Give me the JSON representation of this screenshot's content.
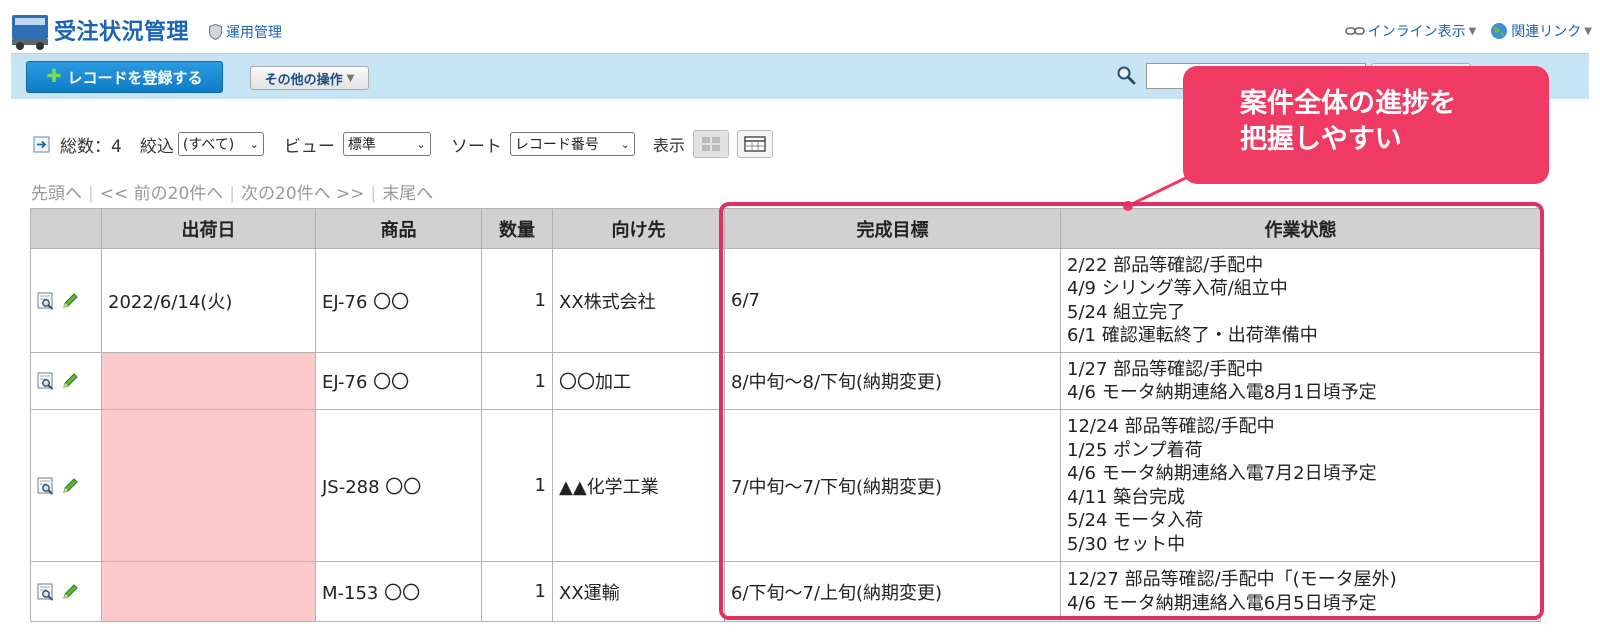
{
  "header": {
    "title": "受注状況管理",
    "admin_label": "運用管理",
    "inline_view": "インライン表示",
    "related_links": "関連リンク"
  },
  "toolbar": {
    "add_record": "レコードを登録する",
    "other_ops": "その他の操作"
  },
  "controls": {
    "total_label": "総数：4",
    "filter_label": "絞込",
    "filter_value": "(すべて)",
    "view_label": "ビュー",
    "view_value": "標準",
    "sort_label": "ソート",
    "sort_value": "レコード番号",
    "display_label": "表示"
  },
  "pager": {
    "first": "先頭へ",
    "prev": "<< 前の20件へ",
    "next": "次の20件へ >>",
    "last": "末尾へ"
  },
  "table": {
    "headers": {
      "ship_date": "出荷日",
      "product": "商品",
      "qty": "数量",
      "dest": "向け先",
      "target": "完成目標",
      "status": "作業状態"
    },
    "rows": [
      {
        "ship_date": "2022/6/14(火)",
        "product": "EJ-76 〇〇",
        "qty": "1",
        "dest": "XX株式会社",
        "target": "6/7",
        "status": [
          "2/22 部品等確認/手配中",
          "4/9 シリング等入荷/組立中",
          "5/24 組立完了",
          "6/1 確認運転終了・出荷準備中"
        ]
      },
      {
        "ship_date": "",
        "product": "EJ-76 〇〇",
        "qty": "1",
        "dest": "〇〇加工",
        "target": "8/中旬～8/下旬(納期変更)",
        "status": [
          "1/27 部品等確認/手配中",
          "4/6 モータ納期連絡入電8月1日頃予定"
        ]
      },
      {
        "ship_date": "",
        "product": "JS-288 〇〇",
        "qty": "1",
        "dest": "▲▲化学工業",
        "target": "7/中旬～7/下旬(納期変更)",
        "status": [
          "12/24 部品等確認/手配中",
          "1/25 ポンプ着荷",
          "4/6 モータ納期連絡入電7月2日頃予定",
          "4/11 築台完成",
          "5/24 モータ入荷",
          "5/30 セット中"
        ]
      },
      {
        "ship_date": "",
        "product": "M-153 〇〇",
        "qty": "1",
        "dest": "XX運輸",
        "target": "6/下旬～7/上旬(納期変更)",
        "status": [
          "12/27 部品等確認/手配中「(モータ屋外)",
          "4/6 モータ納期連絡入電6月5日頃予定"
        ]
      }
    ]
  },
  "callout": {
    "line1": "案件全体の進捗を",
    "line2": "把握しやすい"
  },
  "colors": {
    "accent": "#ef3b63",
    "title_blue": "#1a63b6",
    "toolbar_bg": "#c6e4f4",
    "empty_cell": "#fbc9ca"
  }
}
